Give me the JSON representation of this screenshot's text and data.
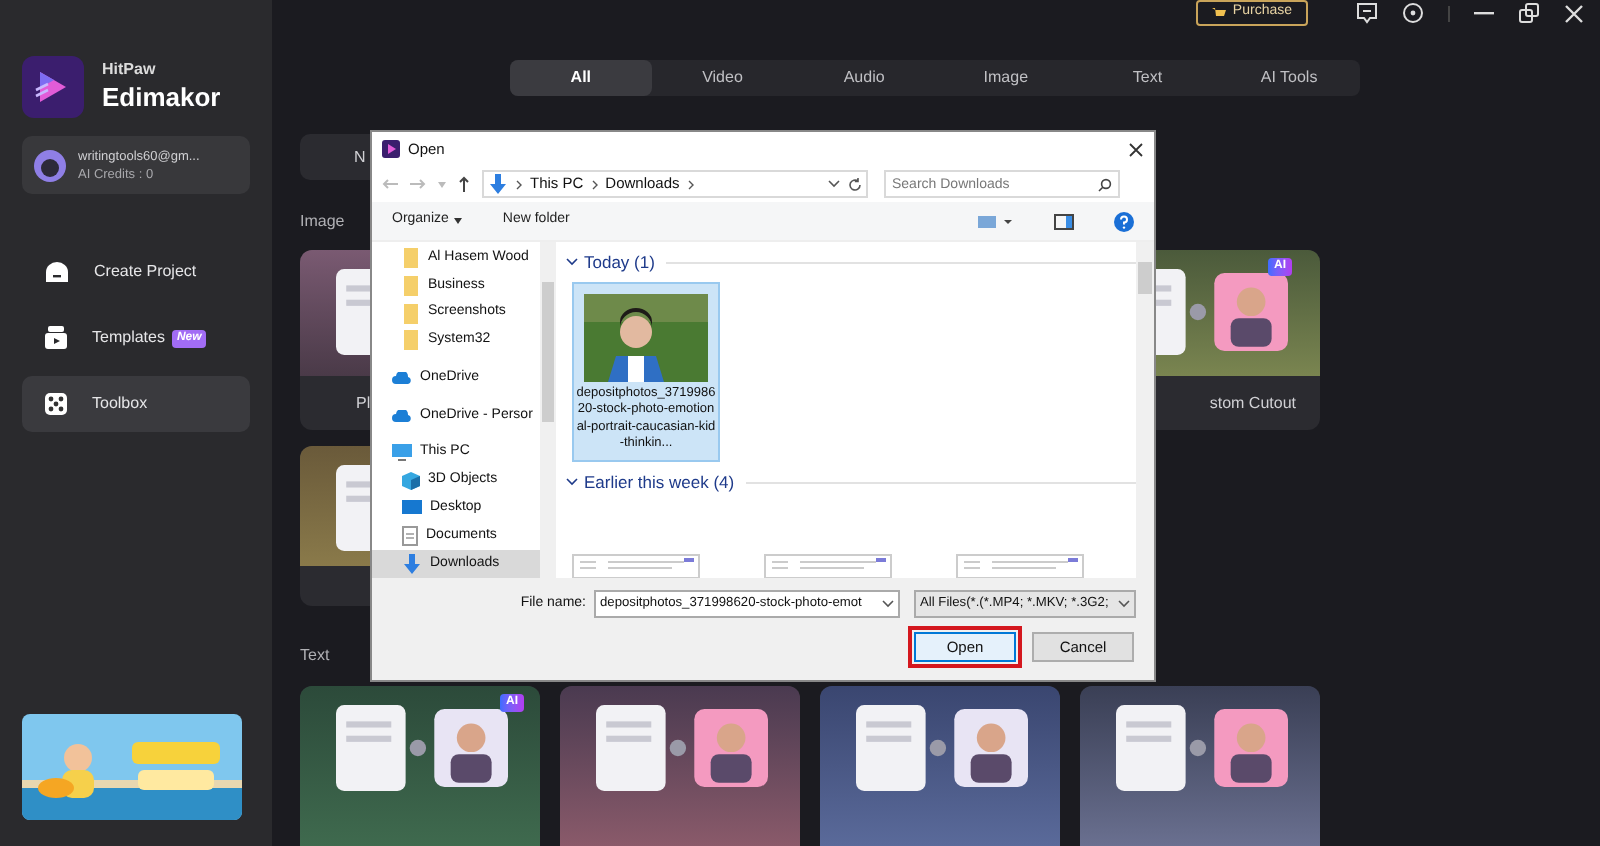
{
  "sidebar": {
    "brand": "HitPaw",
    "product": "Edimakor",
    "account": {
      "email": "writingtools60@gm...",
      "credits": "AI Credits : 0"
    },
    "items": [
      {
        "label": "Create Project",
        "kind": "create",
        "selected": false
      },
      {
        "label": "Templates",
        "kind": "templates",
        "badge": "New",
        "selected": false
      },
      {
        "label": "Toolbox",
        "kind": "toolbox",
        "selected": true
      }
    ],
    "promo": {
      "kind": "picture"
    }
  },
  "top_bar": {
    "purchase": "Purchase"
  },
  "tabs": [
    {
      "label": "All",
      "selected": true
    },
    {
      "label": "Video",
      "selected": false
    },
    {
      "label": "Audio",
      "selected": false
    },
    {
      "label": "Image",
      "selected": false
    },
    {
      "label": "Text",
      "selected": false
    },
    {
      "label": "AI Tools",
      "selected": false
    }
  ],
  "content": {
    "top_card": {
      "caption": "N"
    },
    "image_label": "Image",
    "image_cards": [
      {
        "caption": "Pl",
        "kind": "picture"
      },
      {
        "caption": "stom Cutout",
        "badge": "AI",
        "kind": "picture"
      }
    ],
    "second_card": {
      "kind": "picture"
    },
    "text_label": "Text",
    "text_cards": [
      {
        "kind": "picture",
        "badge": "AI"
      },
      {
        "kind": "picture"
      },
      {
        "kind": "picture"
      },
      {
        "kind": "picture"
      }
    ]
  },
  "dialog": {
    "title": "Open",
    "path": [
      "This PC",
      "Downloads"
    ],
    "search_placeholder": "Search Downloads",
    "organize": "Organize",
    "new_folder": "New folder",
    "nav": [
      {
        "label": "Al Hasem Wood",
        "kind": "folder",
        "selected": false
      },
      {
        "label": "Business",
        "kind": "folder",
        "selected": false
      },
      {
        "label": "Screenshots",
        "kind": "folder",
        "selected": false
      },
      {
        "label": "System32",
        "kind": "folder",
        "selected": false
      },
      {
        "label": "OneDrive",
        "kind": "cloud",
        "selected": false
      },
      {
        "label": "OneDrive - Persor",
        "kind": "cloud",
        "selected": false
      },
      {
        "label": "This PC",
        "kind": "pc",
        "selected": false,
        "children": [
          {
            "label": "3D Objects",
            "kind": "objects",
            "selected": false
          },
          {
            "label": "Desktop",
            "kind": "desktop",
            "selected": false
          },
          {
            "label": "Documents",
            "kind": "documents",
            "selected": false
          },
          {
            "label": "Downloads",
            "kind": "downloads",
            "selected": true
          }
        ]
      }
    ],
    "groups": [
      {
        "title": "Today (1)",
        "files": [
          {
            "name": "depositphotos_371998620-stock-photo-emotional-portrait-caucasian-kid-thinkin...",
            "selected": true
          }
        ]
      },
      {
        "title": "Earlier this week (4)",
        "files": [
          {
            "kind": "document",
            "selected": false
          },
          {
            "kind": "document",
            "selected": false
          },
          {
            "kind": "document",
            "selected": false
          }
        ]
      }
    ],
    "file_name_label": "File name:",
    "file_name": "depositphotos_371998620-stock-photo-emot",
    "filter": "All Files(*.(*.MP4; *.MKV; *.3G2;",
    "buttons": [
      {
        "label": "Open",
        "focused": true
      },
      {
        "label": "Cancel",
        "focused": false
      }
    ]
  }
}
